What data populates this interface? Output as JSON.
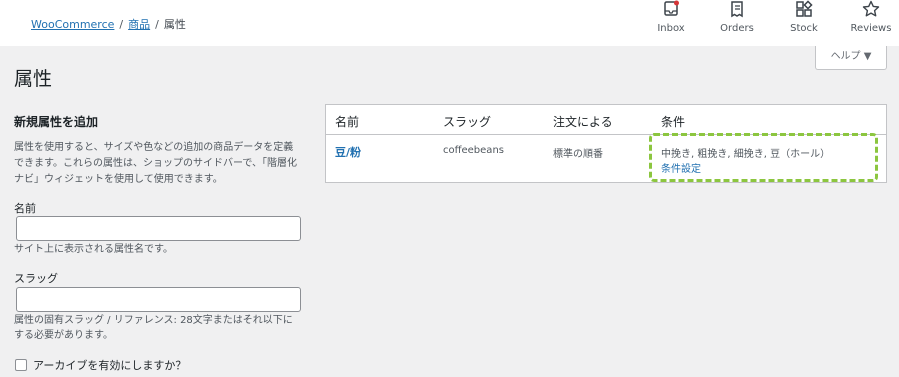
{
  "breadcrumb": {
    "items": [
      {
        "label": "WooCommerce",
        "link": true
      },
      {
        "label": "商品",
        "link": true
      },
      {
        "label": "属性",
        "link": false
      }
    ],
    "separator": "/"
  },
  "topnav": {
    "items": [
      {
        "label": "Inbox",
        "icon": "inbox-icon"
      },
      {
        "label": "Orders",
        "icon": "orders-icon"
      },
      {
        "label": "Stock",
        "icon": "stock-icon"
      },
      {
        "label": "Reviews",
        "icon": "star-icon"
      }
    ]
  },
  "help_tab": {
    "label": "ヘルプ ▼"
  },
  "page_title": "属性",
  "add_form": {
    "title": "新規属性を追加",
    "description": "属性を使用すると、サイズや色などの追加の商品データを定義できます。これらの属性は、ショップのサイドバーで、「階層化ナビ」ウィジェットを使用して使用できます。",
    "name_label": "名前",
    "name_value": "",
    "name_help": "サイト上に表示される属性名です。",
    "slug_label": "スラッグ",
    "slug_value": "",
    "slug_help": "属性の固有スラッグ / リファレンス: 28文字またはそれ以下にする必要があります。",
    "archive_label": "アーカイブを有効にしますか？"
  },
  "table": {
    "headers": [
      "名前",
      "スラッグ",
      "注文による",
      "条件"
    ],
    "rows": [
      {
        "name": "豆/粉",
        "slug": "coffeebeans",
        "order": "標準の順番",
        "terms": "中挽き, 粗挽き, 細挽き, 豆（ホール）",
        "configure": "条件設定"
      }
    ]
  },
  "colors": {
    "accent": "#2271b1",
    "highlight": "#8cc63f",
    "background": "#f0f0f1"
  }
}
